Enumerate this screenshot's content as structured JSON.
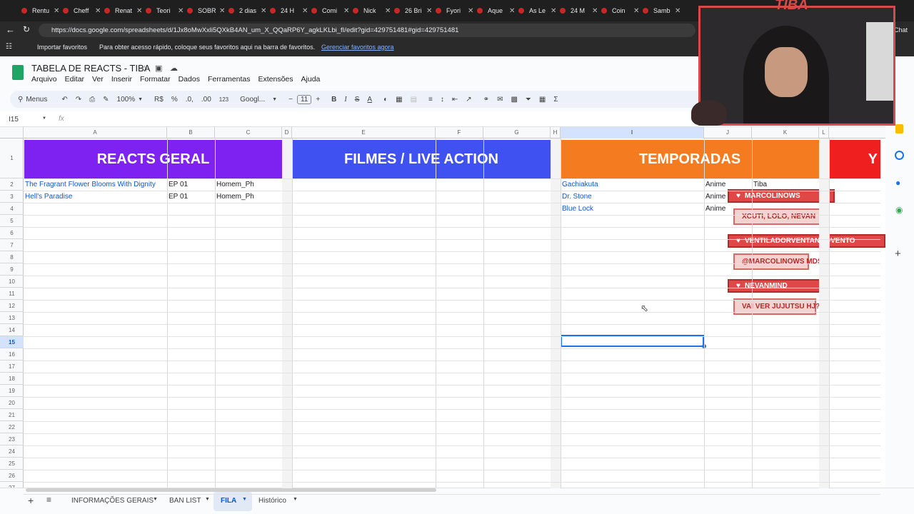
{
  "browser": {
    "tabs": [
      {
        "label": "Rentu"
      },
      {
        "label": "Cheff"
      },
      {
        "label": "Renat"
      },
      {
        "label": "Teori"
      },
      {
        "label": "SOBR"
      },
      {
        "label": "2 dias"
      },
      {
        "label": "24 H"
      },
      {
        "label": "Comi"
      },
      {
        "label": "Nick"
      },
      {
        "label": "26 Bri"
      },
      {
        "label": "Fyori"
      },
      {
        "label": "Aque"
      },
      {
        "label": "As Le"
      },
      {
        "label": "24 M"
      },
      {
        "label": "Coin"
      },
      {
        "label": "Samb"
      }
    ],
    "tab_close": "✕",
    "url": "https://docs.google.com/spreadsheets/d/1Jx8oMwXxli5QXkB4AN_um_X_QQaRP6Y_agkLKLbi_fI/edit?gid=429751481#gid=429751481",
    "bookmarks": {
      "import_label": "Importar favoritos",
      "hint": "Para obter acesso rápido, coloque seus favoritos aqui na barra de favoritos.",
      "manage_link": "Gerenciar favoritos agora"
    }
  },
  "sheets": {
    "title": "TABELA DE REACTS - TIBA",
    "menu": [
      "Arquivo",
      "Editar",
      "Ver",
      "Inserir",
      "Formatar",
      "Dados",
      "Ferramentas",
      "Extensões",
      "Ajuda"
    ],
    "toolbar": {
      "menus_label": "Menus",
      "zoom": "100%",
      "currency": "R$",
      "percent": "%",
      "dec_less": ".0,",
      "dec_more": ".00",
      "format_123": "123",
      "font": "Googl...",
      "font_size": "11"
    },
    "cell_ref": "I15",
    "fx": "fx",
    "columns": [
      "A",
      "B",
      "C",
      "D",
      "E",
      "F",
      "G",
      "H",
      "I",
      "J",
      "K",
      "L"
    ],
    "rows": [
      "1",
      "2",
      "3",
      "4",
      "5",
      "6",
      "7",
      "8",
      "9",
      "10",
      "11",
      "12",
      "13",
      "14",
      "15",
      "16",
      "17",
      "18",
      "19",
      "20",
      "21",
      "22",
      "23",
      "24",
      "25",
      "26",
      "27"
    ],
    "banners": {
      "reacts": {
        "label": "REACTS GERAL",
        "color": "#7e22f2"
      },
      "filmes": {
        "label": "FILMES / LIVE ACTION",
        "color": "#3f51f0"
      },
      "temporadas": {
        "label": "TEMPORADAS",
        "color": "#f47b20"
      },
      "extra": {
        "label": "Y",
        "color": "#ef1f1f"
      }
    },
    "reacts_rows": [
      {
        "title": "The Fragrant Flower Blooms With Dignity",
        "ep": "EP 01",
        "who": "Homem_Ph"
      },
      {
        "title": "Hell's Paradise",
        "ep": "EP 01",
        "who": "Homem_Ph"
      }
    ],
    "temporadas_rows": [
      {
        "title": "Gachiakuta",
        "type": "Anime",
        "who": "Tiba"
      },
      {
        "title": "Dr. Stone",
        "type": "Anime",
        "who": ""
      },
      {
        "title": "Blue Lock",
        "type": "Anime",
        "who": ""
      }
    ],
    "sheet_tabs": {
      "info": "INFORMAÇÕES GERAIS",
      "ban": "BAN LIST",
      "fila": "FILA",
      "hist": "Histórico"
    },
    "side_chat": "Chat"
  },
  "stream": {
    "logo": "TIBA",
    "chat": [
      {
        "name": "MARCOLINOWS",
        "message": "XCUTI, LOLO, NEVAN"
      },
      {
        "name": "VENTILADORVENTANDOVENTO",
        "message": "@MARCOLINOWS MDS"
      },
      {
        "name": "NEVANMIND",
        "message": "VAI VER JUJUTSU HJ?"
      }
    ]
  }
}
